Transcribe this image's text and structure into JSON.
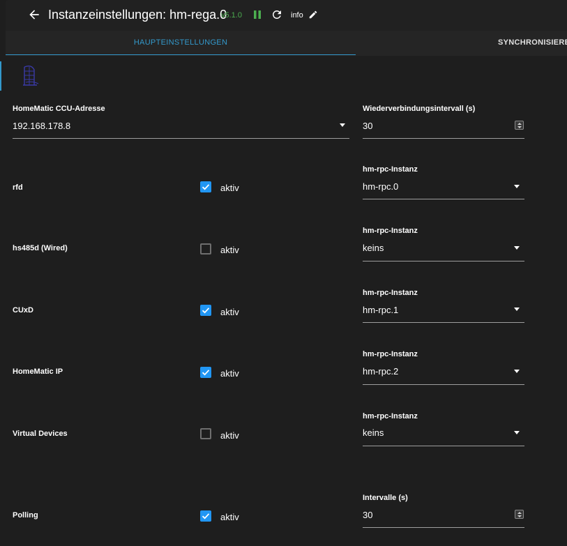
{
  "header": {
    "title": "Instanzeinstellungen: hm-rega.0",
    "version": "v5.1.0",
    "info_label": "info"
  },
  "tabs": [
    {
      "label": "HAUPTEINSTELLUNGEN",
      "active": true
    },
    {
      "label": "SYNCHRONISIERE",
      "active": false
    }
  ],
  "ccu": {
    "label": "HomeMatic CCU-Adresse",
    "value": "192.168.178.8"
  },
  "reconnect": {
    "label": "Wiederverbindungsintervall (s)",
    "value": "30"
  },
  "rows": [
    {
      "label": "rfd",
      "checked": true,
      "checkbox_label": "aktiv",
      "select_label": "hm-rpc-Instanz",
      "select_value": "hm-rpc.0"
    },
    {
      "label": "hs485d (Wired)",
      "checked": false,
      "checkbox_label": "aktiv",
      "select_label": "hm-rpc-Instanz",
      "select_value": "keins"
    },
    {
      "label": "CUxD",
      "checked": true,
      "checkbox_label": "aktiv",
      "select_label": "hm-rpc-Instanz",
      "select_value": "hm-rpc.1"
    },
    {
      "label": "HomeMatic IP",
      "checked": true,
      "checkbox_label": "aktiv",
      "select_label": "hm-rpc-Instanz",
      "select_value": "hm-rpc.2"
    },
    {
      "label": "Virtual Devices",
      "checked": false,
      "checkbox_label": "aktiv",
      "select_label": "hm-rpc-Instanz",
      "select_value": "keins"
    }
  ],
  "polling": {
    "label": "Polling",
    "checked": true,
    "checkbox_label": "aktiv",
    "interval_label": "Intervalle (s)",
    "interval_value": "30"
  },
  "colors": {
    "accent": "#3399cc",
    "checkbox": "#2196f3",
    "version": "#4caf50",
    "background": "#1e1e1e"
  },
  "icons": [
    "arrow-back-icon",
    "pause-icon",
    "reload-icon",
    "pencil-icon",
    "homematic-logo-icon",
    "check-icon",
    "dropdown-caret-icon",
    "number-spinner-icon"
  ]
}
